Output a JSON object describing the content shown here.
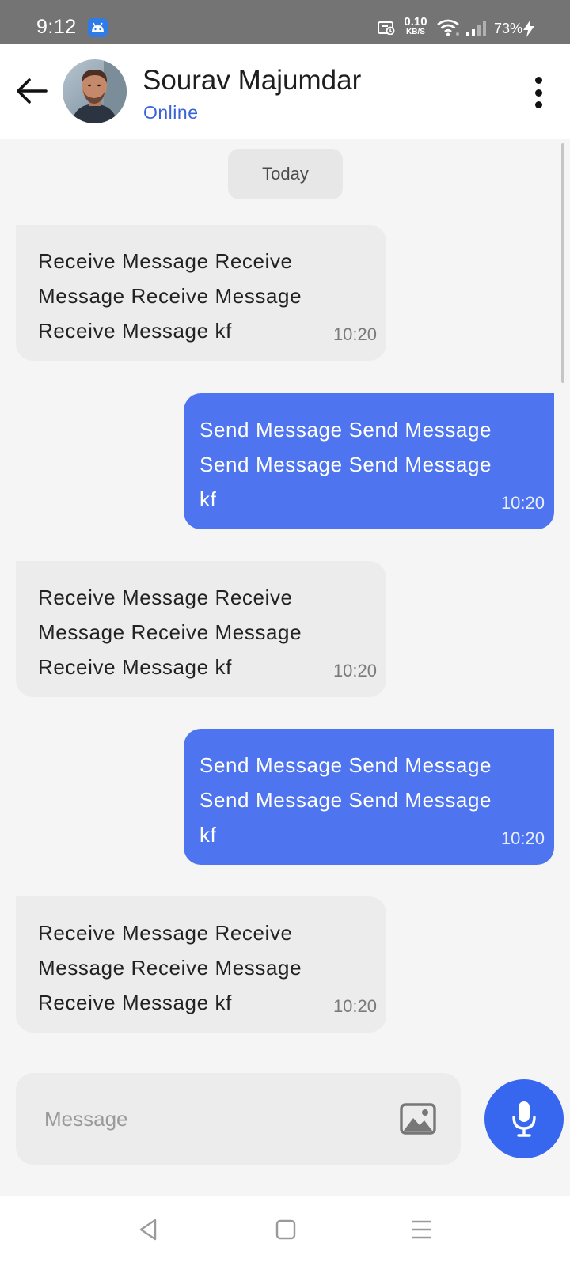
{
  "status_bar": {
    "time": "9:12",
    "network_speed_value": "0.10",
    "network_speed_unit": "KB/S",
    "battery": "73%",
    "icons": [
      "android-app-icon",
      "media-icon",
      "wifi-icon",
      "signal-icon",
      "charging-bolt-icon"
    ]
  },
  "header": {
    "contact_name": "Sourav Majumdar",
    "contact_status": "Online"
  },
  "chat": {
    "date_chip": "Today",
    "messages": [
      {
        "direction": "received",
        "text": "Receive Message Receive Message Receive Message Receive Message kf",
        "time": "10:20"
      },
      {
        "direction": "sent",
        "text": "Send Message Send Message Send Message Send Message kf",
        "time": "10:20"
      },
      {
        "direction": "received",
        "text": "Receive Message Receive Message Receive Message Receive Message kf",
        "time": "10:20"
      },
      {
        "direction": "sent",
        "text": "Send Message Send Message Send Message Send Message kf",
        "time": "10:20"
      },
      {
        "direction": "received",
        "text": "Receive Message Receive Message Receive Message Receive Message kf",
        "time": "10:20"
      }
    ]
  },
  "composer": {
    "placeholder": "Message",
    "value": ""
  },
  "colors": {
    "sent_bubble": "#4e74f0",
    "received_bubble": "#ececec",
    "accent": "#3767ee",
    "online_status": "#3a62d8"
  }
}
